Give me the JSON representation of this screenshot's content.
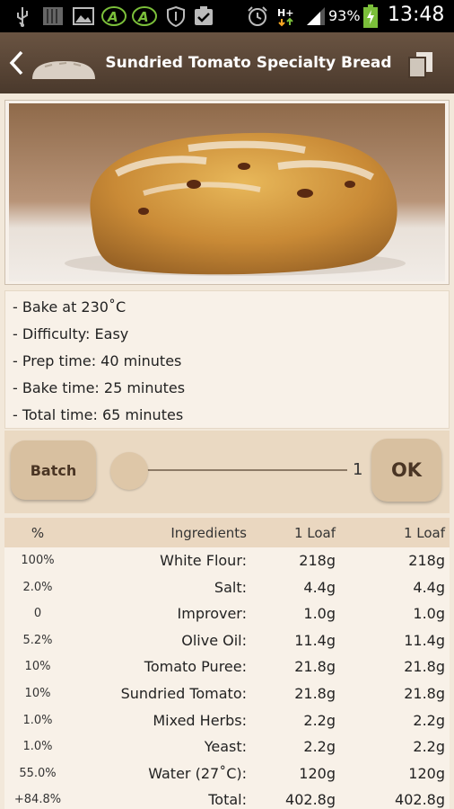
{
  "status_bar": {
    "icons": [
      "usb-icon",
      "storage-icon",
      "image-icon",
      "app-icon",
      "app-icon",
      "shield-icon",
      "clipboard-check-icon",
      "alarm-icon",
      "hplus-data-icon",
      "signal-icon",
      "battery-charging-icon"
    ],
    "battery": "93%",
    "time": "13:48"
  },
  "action_bar": {
    "title": "Sundried Tomato Specialty Bread"
  },
  "info": {
    "lines": [
      "- Bake at 230˚C",
      "- Difficulty: Easy",
      "- Prep time: 40 minutes",
      "- Bake time: 25 minutes",
      "- Total time: 65 minutes"
    ]
  },
  "batch": {
    "batch_label": "Batch",
    "slider_value": "1",
    "slider_level": 0,
    "ok_label": "OK"
  },
  "table": {
    "headers": [
      "%",
      "Ingredients",
      "1 Loaf",
      "1 Loaf"
    ],
    "rows": [
      [
        "100%",
        "White Flour:",
        "218g",
        "218g"
      ],
      [
        "2.0%",
        "Salt:",
        "4.4g",
        "4.4g"
      ],
      [
        "0",
        "Improver:",
        "1.0g",
        "1.0g"
      ],
      [
        "5.2%",
        "Olive Oil:",
        "11.4g",
        "11.4g"
      ],
      [
        "10%",
        "Tomato Puree:",
        "21.8g",
        "21.8g"
      ],
      [
        "10%",
        "Sundried Tomato:",
        "21.8g",
        "21.8g"
      ],
      [
        "1.0%",
        "Mixed Herbs:",
        "2.2g",
        "2.2g"
      ],
      [
        "1.0%",
        "Yeast:",
        "2.2g",
        "2.2g"
      ],
      [
        "55.0%",
        "Water (27˚C):",
        "120g",
        "120g"
      ],
      [
        "+84.8%",
        "Total:",
        "402.8g",
        "402.8g"
      ]
    ]
  },
  "colors": {
    "action_bar": "#5a4636",
    "background": "#f2e8da",
    "button": "#d8c0a0",
    "header_row": "#ead7c0"
  }
}
